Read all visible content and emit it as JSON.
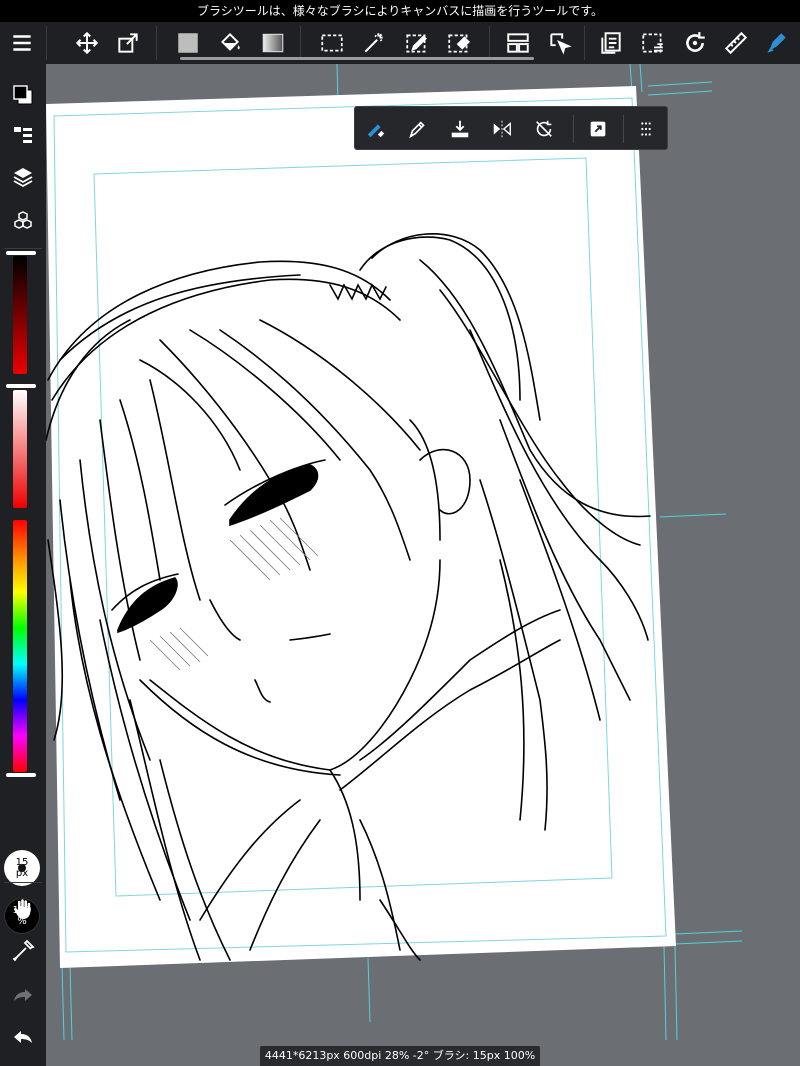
{
  "tip": "ブラシツールは、様々なブラシによりキャンバスに描画を行うツールです。",
  "toolbar": {
    "tools": [
      "menu-icon",
      "move-icon",
      "transform-icon",
      "fill-color-icon",
      "bucket-icon",
      "gradient-icon",
      "select-rect-icon",
      "magic-wand-icon",
      "select-pen-icon",
      "select-eraser-icon",
      "panel-layout-icon",
      "select-layer-icon",
      "copy-icon",
      "clear-icon",
      "rotate-icon",
      "ruler-icon",
      "brush-icon"
    ],
    "active_tool": "brush-icon",
    "active_color": "#2d8fd6"
  },
  "floatbar": {
    "tools": [
      "brush-eraser-icon",
      "pen-icon",
      "snap-icon",
      "mirror-icon",
      "rotate-lock-icon",
      "expand-icon",
      "grid-menu-icon"
    ]
  },
  "sidebar": {
    "brush_size": "15",
    "brush_size_unit": "px",
    "opacity": "100",
    "opacity_unit": "%",
    "color_primary": "#000000",
    "color_secondary": "#ffffff"
  },
  "status": {
    "text": "4441*6213px 600dpi 28% -2° ブラシ: 15px 100%"
  }
}
